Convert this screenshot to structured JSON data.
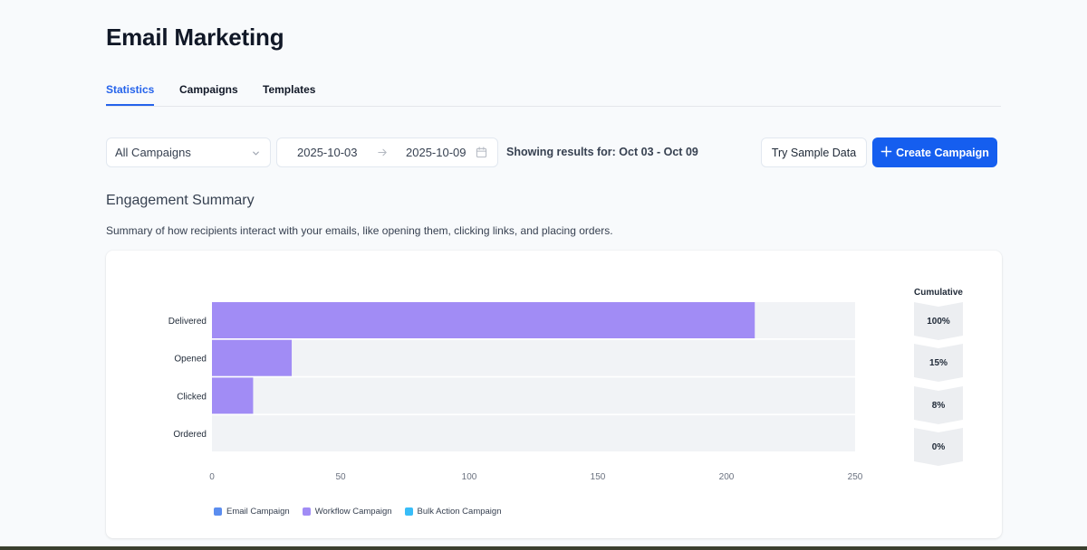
{
  "page": {
    "title": "Email Marketing"
  },
  "tabs": [
    {
      "label": "Statistics",
      "active": true
    },
    {
      "label": "Campaigns",
      "active": false
    },
    {
      "label": "Templates",
      "active": false
    }
  ],
  "filters": {
    "campaign_select": "All Campaigns",
    "date_start": "2025-10-03",
    "date_end": "2025-10-09",
    "results_text": "Showing results for: Oct 03 - Oct 09"
  },
  "actions": {
    "try_sample": "Try Sample Data",
    "create_campaign": "Create Campaign"
  },
  "summary": {
    "title": "Engagement Summary",
    "description": "Summary of how recipients interact with your emails, like opening them, clicking links, and placing orders."
  },
  "colors": {
    "accent": "#155eef",
    "email_campaign": "#5b8def",
    "workflow_campaign": "#a18cf5",
    "bulk_action_campaign": "#38bdf8",
    "track": "#f1f3f6"
  },
  "chart_data": {
    "type": "bar",
    "orientation": "horizontal",
    "stacked": true,
    "categories": [
      "Delivered",
      "Opened",
      "Clicked",
      "Ordered"
    ],
    "series": [
      {
        "name": "Email Campaign",
        "values": [
          0,
          0,
          0,
          0
        ]
      },
      {
        "name": "Workflow Campaign",
        "values": [
          211,
          31,
          16,
          0
        ]
      },
      {
        "name": "Bulk Action Campaign",
        "values": [
          0,
          0,
          0,
          0
        ]
      }
    ],
    "xlim": [
      0,
      250
    ],
    "xticks": [
      0,
      50,
      100,
      150,
      200,
      250
    ],
    "cumulative_title": "Cumulative",
    "cumulative": [
      "100%",
      "15%",
      "8%",
      "0%"
    ],
    "legend_position": "bottom-left",
    "grid": false
  }
}
